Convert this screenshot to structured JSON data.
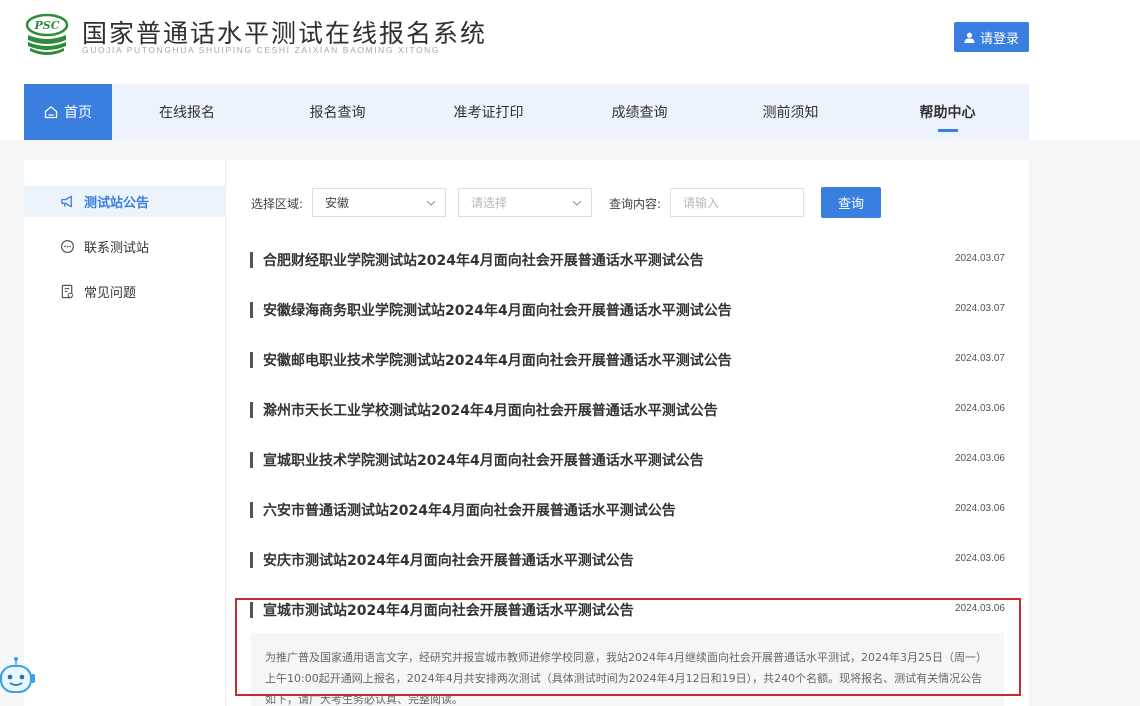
{
  "header": {
    "logo_text": "PSC",
    "title": "国家普通话水平测试在线报名系统",
    "subtitle": "GUOJIA PUTONGHUA SHUIPING CESHI ZAIXIAN BAOMING XITONG",
    "login_label": "请登录"
  },
  "nav": {
    "items": [
      {
        "label": "首页"
      },
      {
        "label": "在线报名"
      },
      {
        "label": "报名查询"
      },
      {
        "label": "准考证打印"
      },
      {
        "label": "成绩查询"
      },
      {
        "label": "测前须知"
      },
      {
        "label": "帮助中心"
      }
    ]
  },
  "sidebar": {
    "items": [
      {
        "label": "测试站公告",
        "icon": "megaphone-icon",
        "active": true
      },
      {
        "label": "联系测试站",
        "icon": "chat-bubble-icon",
        "active": false
      },
      {
        "label": "常见问题",
        "icon": "faq-document-icon",
        "active": false
      }
    ]
  },
  "filter": {
    "region_label": "选择区域:",
    "region_value": "安徽",
    "city_placeholder": "请选择",
    "query_label": "查询内容:",
    "query_placeholder": "请输入",
    "query_button": "查询"
  },
  "announcements": [
    {
      "title": "合肥财经职业学院测试站2024年4月面向社会开展普通话水平测试公告",
      "date": "2024.03.07"
    },
    {
      "title": "安徽绿海商务职业学院测试站2024年4月面向社会开展普通话水平测试公告",
      "date": "2024.03.07"
    },
    {
      "title": "安徽邮电职业技术学院测试站2024年4月面向社会开展普通话水平测试公告",
      "date": "2024.03.07"
    },
    {
      "title": "滁州市天长工业学校测试站2024年4月面向社会开展普通话水平测试公告",
      "date": "2024.03.06"
    },
    {
      "title": "宣城职业技术学院测试站2024年4月面向社会开展普通话水平测试公告",
      "date": "2024.03.06"
    },
    {
      "title": "六安市普通话测试站2024年4月面向社会开展普通话水平测试公告",
      "date": "2024.03.06"
    },
    {
      "title": "安庆市测试站2024年4月面向社会开展普通话水平测试公告",
      "date": "2024.03.06"
    },
    {
      "title": "宣城市测试站2024年4月面向社会开展普通话水平测试公告",
      "date": "2024.03.06"
    }
  ],
  "excerpt": "为推广普及国家通用语言文字，经研究并报宣城市教师进修学校同意，我站2024年4月继续面向社会开展普通话水平测试，2024年3月25日（周一）上午10:00起开通网上报名，2024年4月共安排两次测试（具体测试时间为2024年4月12日和19日），共240个名额。现将报名、测试有关情况公告如下，请广大考生务必认真、完整阅读。",
  "colors": {
    "primary": "#3a7fe0",
    "nav_bg": "#edf3fb",
    "highlight": "#c62b2b",
    "logo_green": "#2e8b3d"
  }
}
